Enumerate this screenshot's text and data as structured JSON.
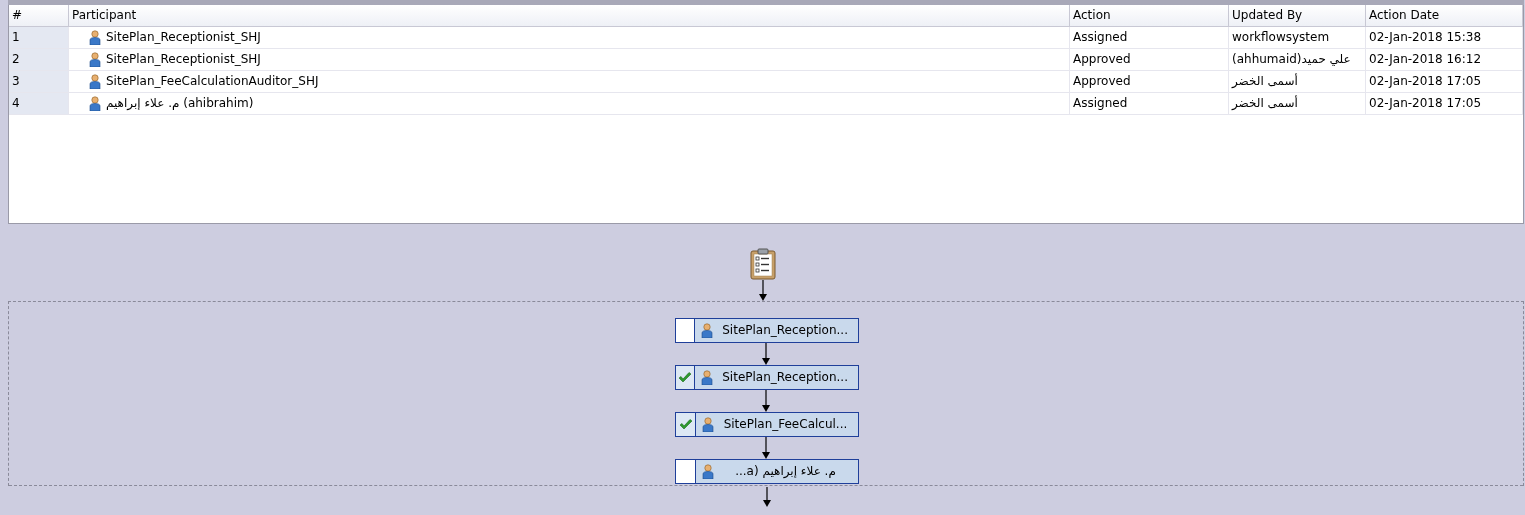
{
  "table": {
    "columns": [
      "#",
      "Participant",
      "Action",
      "Updated By",
      "Action Date"
    ],
    "rows": [
      {
        "index": "1",
        "participant": "SitePlan_Receptionist_SHJ",
        "action": "Assigned",
        "updated_by": "workflowsystem",
        "action_date": "02-Jan-2018 15:38"
      },
      {
        "index": "2",
        "participant": "SitePlan_Receptionist_SHJ",
        "action": "Approved",
        "updated_by": "(ahhumaid)علي حميد",
        "action_date": "02-Jan-2018 16:12"
      },
      {
        "index": "3",
        "participant": "SitePlan_FeeCalculationAuditor_SHJ",
        "action": "Approved",
        "updated_by": "أسمى الخضر",
        "action_date": "02-Jan-2018 17:05"
      },
      {
        "index": "4",
        "participant": "م. علاء إبراهيم (ahibrahim)",
        "action": "Assigned",
        "updated_by": "أسمى الخضر",
        "action_date": "02-Jan-2018 17:05"
      }
    ]
  },
  "workflow": {
    "nodes": [
      {
        "label": "SitePlan_Reception...",
        "checked": false
      },
      {
        "label": "SitePlan_Reception...",
        "checked": true
      },
      {
        "label": "SitePlan_FeeCalcul...",
        "checked": true
      },
      {
        "label": "م. علاء إبراهيم (a...",
        "checked": false
      }
    ]
  }
}
